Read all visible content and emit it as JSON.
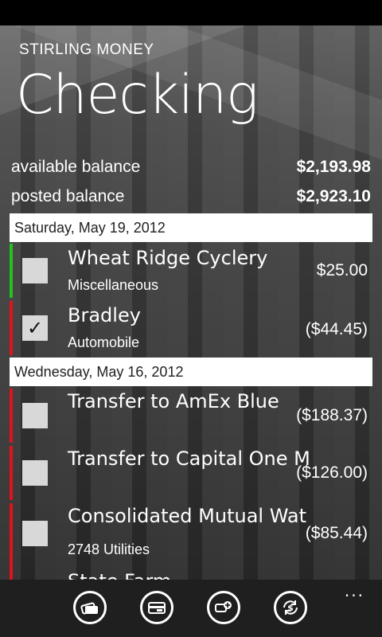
{
  "app": {
    "name": "STIRLING MONEY",
    "title": "Checking"
  },
  "balances": [
    {
      "label": "available balance",
      "value": "$2,193.98"
    },
    {
      "label": "posted balance",
      "value": "$2,923.10"
    }
  ],
  "groups": [
    {
      "date": "Saturday, May 19, 2012",
      "transactions": [
        {
          "name": "Wheat Ridge Cyclery",
          "category": "Miscellaneous",
          "amount": "$25.00",
          "checked": false,
          "status_color": "#22c41c"
        },
        {
          "name": "Bradley",
          "category": "Automobile",
          "amount": "($44.45)",
          "checked": true,
          "status_color": "#e3121a"
        }
      ]
    },
    {
      "date": "Wednesday, May 16, 2012",
      "transactions": [
        {
          "name": "Transfer to AmEx Blue",
          "category": "",
          "amount": "($188.37)",
          "checked": false,
          "status_color": "#e3121a"
        },
        {
          "name": "Transfer to Capital One M",
          "category": "",
          "amount": "($126.00)",
          "checked": false,
          "status_color": "#e3121a"
        },
        {
          "name": "Consolidated Mutual Wat",
          "category": "2748  Utilities",
          "amount": "($85.44)",
          "checked": false,
          "status_color": "#e3121a"
        },
        {
          "name": "State Farm",
          "category": "",
          "amount": "",
          "checked": false,
          "status_color": "#e3121a"
        }
      ]
    }
  ],
  "appbar": {
    "buttons": [
      {
        "icon": "accounts-icon"
      },
      {
        "icon": "card-icon"
      },
      {
        "icon": "payee-icon"
      },
      {
        "icon": "transfer-icon"
      }
    ],
    "more": "..."
  },
  "check_glyph": "✓"
}
